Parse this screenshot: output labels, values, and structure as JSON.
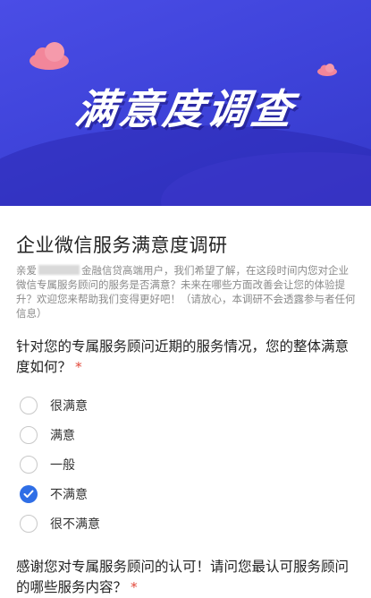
{
  "banner": {
    "title": "满意度调查",
    "gradient_start": "#4a4de6",
    "gradient_end": "#3538c9",
    "decor_color": "#f2869a"
  },
  "survey": {
    "title": "企业微信服务满意度调研",
    "intro_prefix": "亲爱",
    "intro_rest": "金融信贷高端用户，我们希望了解，在这段时间内您对企业微信专属服务顾问的服务是否满意？未来在哪些方面改善会让您的体验提升？欢迎您来帮助我们变得更好吧！（请放心，本调研不会透露参与者任何信息）"
  },
  "question1": {
    "text": "针对您的专属服务顾问近期的服务情况，您的整体满意度如何？",
    "required": "*",
    "options": [
      {
        "label": "很满意",
        "checked": false
      },
      {
        "label": "满意",
        "checked": false
      },
      {
        "label": "一般",
        "checked": false
      },
      {
        "label": "不满意",
        "checked": true
      },
      {
        "label": "很不满意",
        "checked": false
      }
    ]
  },
  "question2": {
    "text": "感谢您对专属服务顾问的认可！请问您最认可服务顾问的哪些服务内容？",
    "required": "*"
  },
  "colors": {
    "accent": "#2f6ee6",
    "required": "#e2483a",
    "muted_text": "#8a8a8a"
  }
}
